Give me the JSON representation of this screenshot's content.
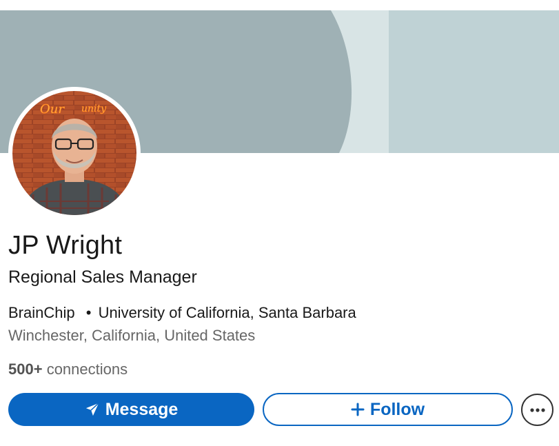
{
  "colors": {
    "accent": "#0a66c2",
    "banner_left": "#9fb1b5",
    "banner_stripe": "#d8e4e5",
    "banner_right": "#bfd2d5",
    "text_primary": "#191919",
    "text_secondary": "#666666"
  },
  "profile": {
    "name": "JP Wright",
    "headline": "Regional Sales Manager",
    "company": "BrainChip",
    "separator": "•",
    "school": "University of California, Santa Barbara",
    "location": "Winchester, California, United States",
    "connections_count": "500+",
    "connections_label": "connections",
    "avatar_neon_text": "Our Community"
  },
  "actions": {
    "message_label": "Message",
    "message_icon": "paper-plane-icon",
    "follow_label": "Follow",
    "follow_icon": "plus-icon",
    "more_icon": "more-horizontal-icon"
  }
}
